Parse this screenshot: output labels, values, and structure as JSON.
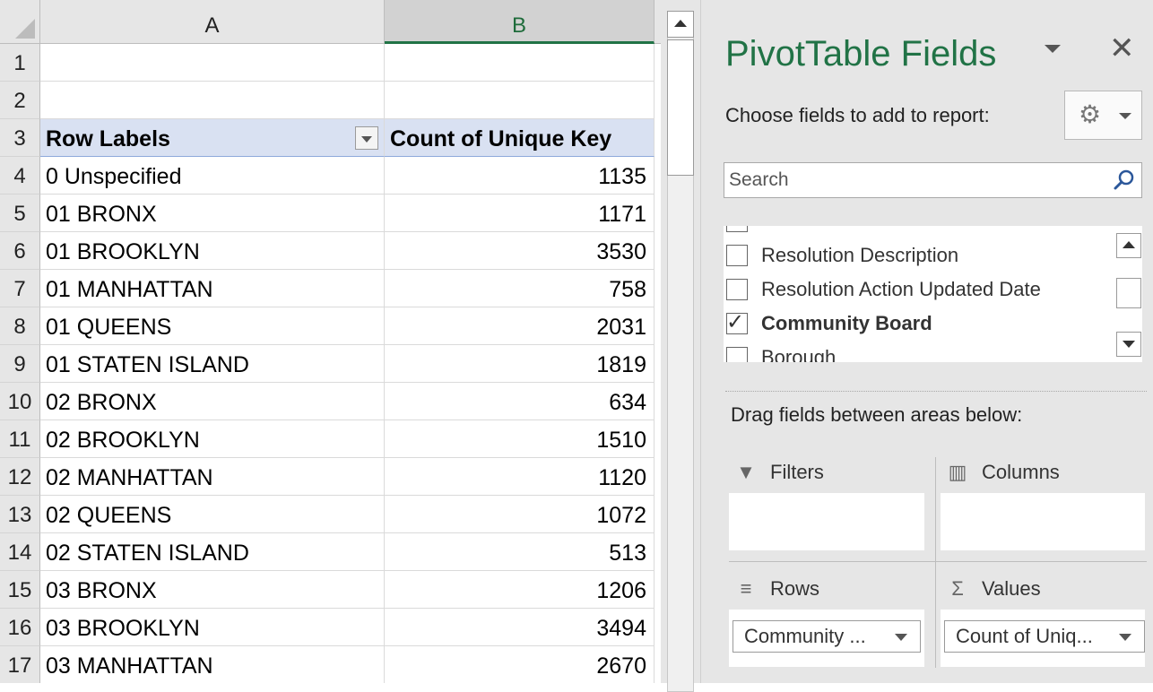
{
  "spreadsheet": {
    "columns": [
      "A",
      "B"
    ],
    "selected_column": "B",
    "row_numbers": [
      "1",
      "2",
      "3",
      "4",
      "5",
      "6",
      "7",
      "8",
      "9",
      "10",
      "11",
      "12",
      "13",
      "14",
      "15",
      "16",
      "17"
    ],
    "pivot_header": {
      "row_labels": "Row Labels",
      "value_header": "Count of Unique Key"
    },
    "rows": [
      {
        "label": "0 Unspecified",
        "value": "1135"
      },
      {
        "label": "01 BRONX",
        "value": "1171"
      },
      {
        "label": "01 BROOKLYN",
        "value": "3530"
      },
      {
        "label": "01 MANHATTAN",
        "value": "758"
      },
      {
        "label": "01 QUEENS",
        "value": "2031"
      },
      {
        "label": "01 STATEN ISLAND",
        "value": "1819"
      },
      {
        "label": "02 BRONX",
        "value": "634"
      },
      {
        "label": "02 BROOKLYN",
        "value": "1510"
      },
      {
        "label": "02 MANHATTAN",
        "value": "1120"
      },
      {
        "label": "02 QUEENS",
        "value": "1072"
      },
      {
        "label": "02 STATEN ISLAND",
        "value": "513"
      },
      {
        "label": "03 BRONX",
        "value": "1206"
      },
      {
        "label": "03 BROOKLYN",
        "value": "3494"
      },
      {
        "label": "03 MANHATTAN",
        "value": "2670"
      }
    ]
  },
  "pivot_pane": {
    "title": "PivotTable Fields",
    "close_glyph": "✕",
    "choose_text": "Choose fields to add to report:",
    "gear_glyph": "⚙",
    "search_placeholder": "Search",
    "fields": [
      {
        "label": "Resolution Description",
        "checked": false
      },
      {
        "label": "Resolution Action Updated Date",
        "checked": false
      },
      {
        "label": "Community Board",
        "checked": true
      },
      {
        "label": "Borough",
        "checked": false
      }
    ],
    "drag_text": "Drag fields between areas below:",
    "areas": {
      "filters": {
        "label": "Filters",
        "icon": "filter-icon",
        "glyph": "▼"
      },
      "columns": {
        "label": "Columns",
        "icon": "columns-icon",
        "glyph": "▥"
      },
      "rows": {
        "label": "Rows",
        "icon": "rows-icon",
        "glyph": "≡",
        "item": "Community ..."
      },
      "values": {
        "label": "Values",
        "icon": "sigma-icon",
        "glyph": "Σ",
        "item": "Count of Uniq..."
      }
    },
    "colors": {
      "title": "#217346",
      "header_fill": "#d9e1f2"
    }
  }
}
